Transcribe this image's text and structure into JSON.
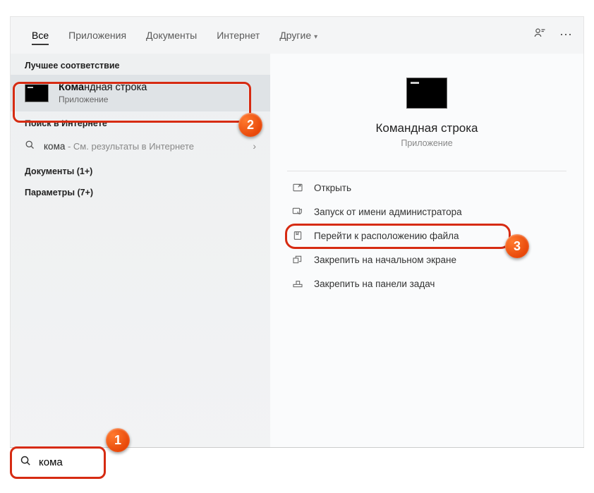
{
  "tabs": {
    "all": "Все",
    "apps": "Приложения",
    "docs": "Документы",
    "web": "Интернет",
    "more": "Другие"
  },
  "sections": {
    "best_match": "Лучшее соответствие",
    "web_search": "Поиск в Интернете",
    "documents": "Документы (1+)",
    "settings": "Параметры (7+)"
  },
  "best_match": {
    "title_bold": "Кома",
    "title_rest": "ндная строка",
    "subtitle": "Приложение"
  },
  "web_result": {
    "query": "кома",
    "hint": " - См. результаты в Интернете"
  },
  "detail": {
    "title": "Командная строка",
    "subtitle": "Приложение"
  },
  "actions": {
    "open": "Открыть",
    "run_admin": "Запуск от имени администратора",
    "open_location": "Перейти к расположению файла",
    "pin_start": "Закрепить на начальном экране",
    "pin_taskbar": "Закрепить на панели задач"
  },
  "search": {
    "value": "кома"
  },
  "badges": {
    "b1": "1",
    "b2": "2",
    "b3": "3"
  }
}
